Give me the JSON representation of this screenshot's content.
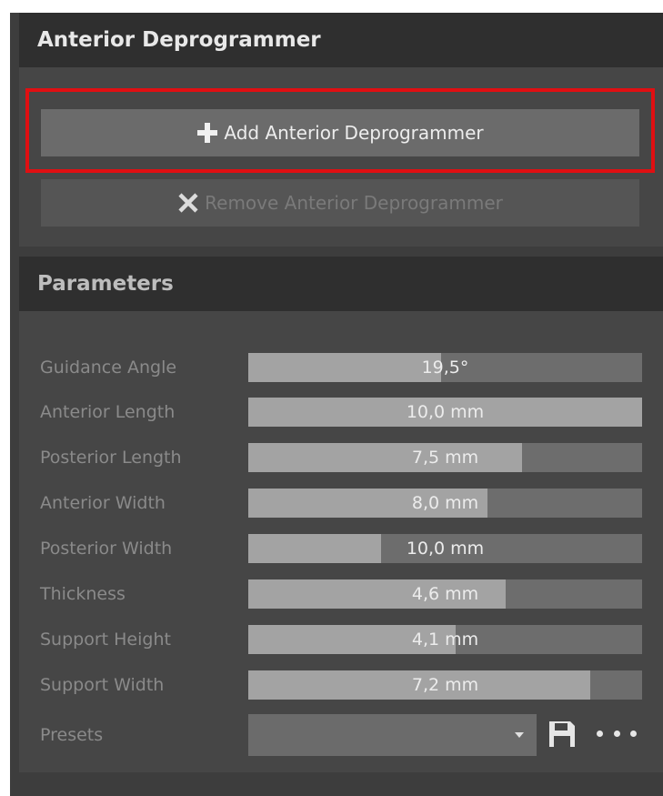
{
  "section1": {
    "title": "Anterior Deprogrammer",
    "add_button_label": "Add Anterior Deprogrammer",
    "add_button_icon": "plus-icon",
    "remove_button_label": "Remove Anterior Deprogrammer",
    "remove_button_icon": "x-icon",
    "highlight_color": "#e00f12"
  },
  "section2": {
    "title": "Parameters",
    "params": [
      {
        "label": "Guidance Angle",
        "value": "19,5°",
        "fill_fraction": 0.49
      },
      {
        "label": "Anterior Length",
        "value": "10,0 mm",
        "fill_fraction": 1.0
      },
      {
        "label": "Posterior Length",
        "value": "7,5 mm",
        "fill_fraction": 0.695
      },
      {
        "label": "Anterior Width",
        "value": "8,0 mm",
        "fill_fraction": 0.607
      },
      {
        "label": "Posterior Width",
        "value": "10,0 mm",
        "fill_fraction": 0.337
      },
      {
        "label": "Thickness",
        "value": "4,6 mm",
        "fill_fraction": 0.653
      },
      {
        "label": "Support Height",
        "value": "4,1 mm",
        "fill_fraction": 0.527
      },
      {
        "label": "Support Width",
        "value": "7,2 mm",
        "fill_fraction": 0.868
      }
    ],
    "presets_label": "Presets",
    "presets_value": "",
    "save_icon": "save-icon",
    "more_icon": "more-icon"
  }
}
